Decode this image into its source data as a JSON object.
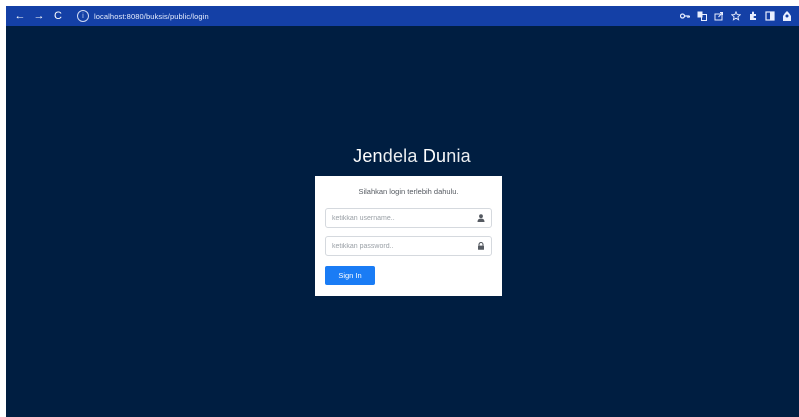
{
  "browser": {
    "back_icon": "←",
    "forward_icon": "→",
    "reload_icon": "C",
    "info_icon": "i",
    "url": "localhost:8080/buksis/public/login",
    "right_icons": [
      "key-icon",
      "translate-icon",
      "share-icon",
      "star-icon",
      "extensions-icon",
      "sidebar-icon",
      "profile-icon"
    ]
  },
  "page": {
    "brand": {
      "part1": "Jen",
      "part2": "dela ",
      "part3": "Du",
      "part4": "nia"
    },
    "card": {
      "message": "Silahkan login terlebih dahulu.",
      "username_placeholder": "ketikkan username..",
      "password_placeholder": "ketikkan password..",
      "submit_label": "Sign In"
    }
  },
  "colors": {
    "toolbar": "#1440a6",
    "page_background": "#001e41",
    "button": "#1a7cf5"
  }
}
